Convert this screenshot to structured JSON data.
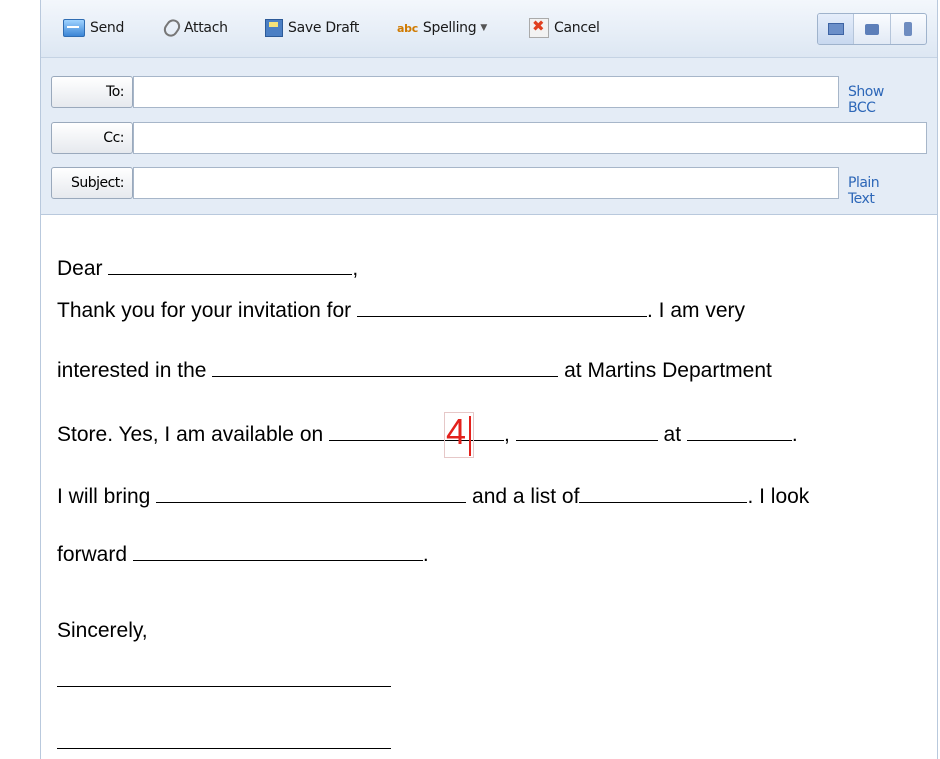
{
  "toolbar": {
    "send": "Send",
    "attach": "Attach",
    "save_draft": "Save Draft",
    "spelling": "Spelling",
    "spelling_icon_text": "abc",
    "cancel": "Cancel",
    "dropdown_caret": "▼"
  },
  "fields": {
    "to_label": "To:",
    "cc_label": "Cc:",
    "subject_label": "Subject:",
    "show_bcc": "Show BCC",
    "plain_text": "Plain Text",
    "to_value": "",
    "cc_value": "",
    "subject_value": ""
  },
  "letter": {
    "line1_a": "Dear ",
    "line1_b": ",",
    "line2_a": "Thank you for your invitation for ",
    "line2_b": ". I am very",
    "line3_a": "interested in the ",
    "line3_b": " at Martins Department",
    "line4_a": "Store.   Yes, I am available on ",
    "line4_b": ", ",
    "line4_c": " at ",
    "line4_d": ".",
    "line5_a": "I will bring ",
    "line5_b": " and a list of",
    "line5_c": ".  I look",
    "line6_a": "forward ",
    "line6_b": ".",
    "closing": "Sincerely,",
    "typed_digit": "4"
  },
  "colors": {
    "accent_link": "#2d67b8",
    "typed_red": "#e3211c"
  }
}
